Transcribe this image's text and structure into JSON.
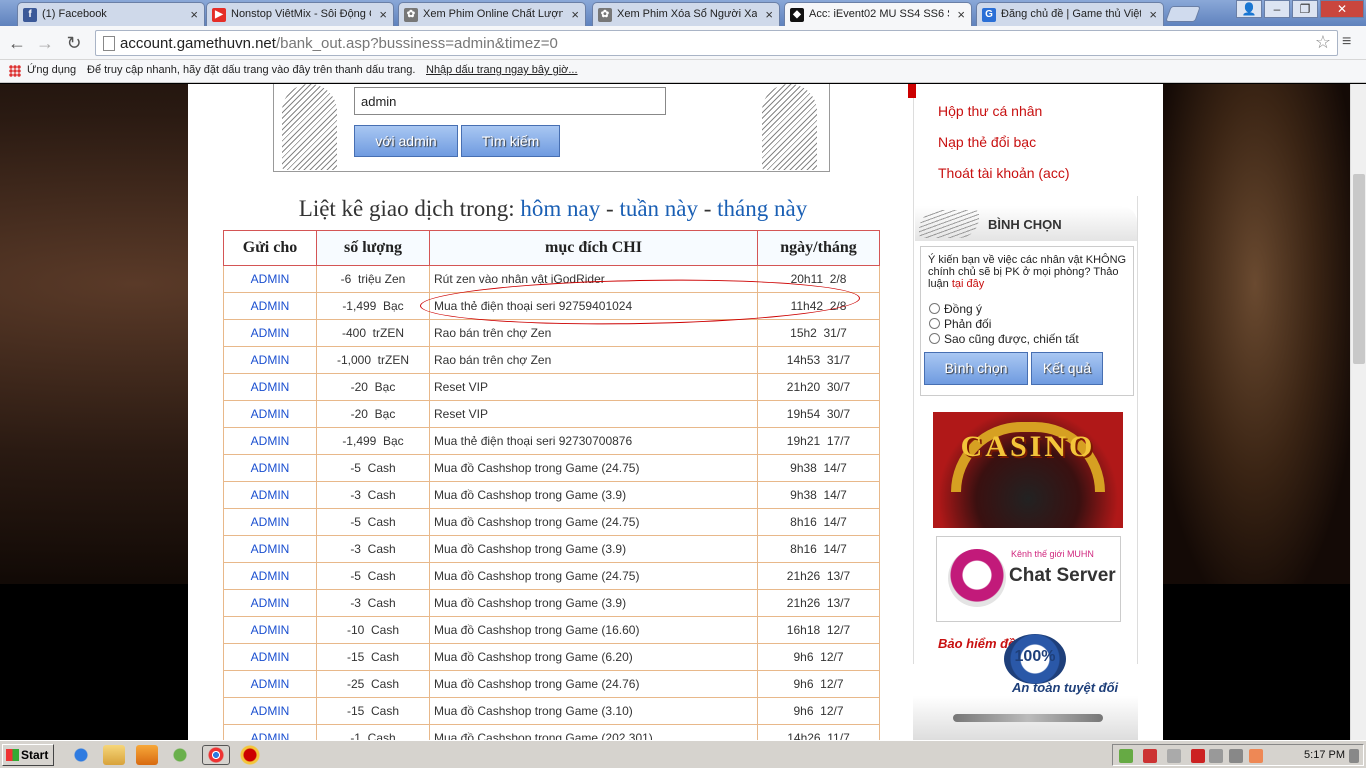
{
  "browser": {
    "tabs": [
      {
        "title": "(1) Facebook",
        "icon": "facebook-icon",
        "color": "#3b5998",
        "glyph": "f"
      },
      {
        "title": "Nonstop ViêtMix - Sôi Động C",
        "icon": "youtube-icon",
        "color": "#e52d27",
        "glyph": "▶"
      },
      {
        "title": "Xem Phim Online Chất Lượng",
        "icon": "film-icon",
        "color": "#777777",
        "glyph": "✿"
      },
      {
        "title": "Xem Phim Xóa Sổ Người Xay",
        "icon": "film-icon",
        "color": "#777777",
        "glyph": "✿"
      },
      {
        "title": "Acc: iEvent02 MU SS4 SS6 S",
        "icon": "gamethu-icon",
        "color": "#111111",
        "glyph": "◆"
      },
      {
        "title": "Đăng chủ đề | Game thủ Việt",
        "icon": "g-site-icon",
        "color": "#2a6fd6",
        "glyph": "G"
      }
    ],
    "active_tab": 4,
    "url_host": "account.gamethuvn.net",
    "url_path": "/bank_out.asp?bussiness=admin&timez=0",
    "bookmarks": {
      "apps_label": "Ứng dụng",
      "hint": "Để truy cập nhanh, hãy đặt dấu trang vào đây trên thanh dấu trang.",
      "import_link": "Nhập dấu trang ngay bây giờ..."
    }
  },
  "search": {
    "value": "admin",
    "btn_with": "với admin",
    "btn_search": "Tìm kiếm"
  },
  "list_title": {
    "prefix": "Liệt kê giao dịch trong: ",
    "today": "hôm nay",
    "sep": " - ",
    "week": "tuần này",
    "month": "tháng này"
  },
  "table": {
    "headers": [
      "Gửi cho",
      "số lượng",
      "mục đích CHI",
      "ngày/tháng"
    ],
    "rows": [
      [
        "ADMIN",
        "-6  triệu Zen",
        "Rút zen vào nhân vật iGodRider",
        "20h11  2/8"
      ],
      [
        "ADMIN",
        "-1,499  Bạc",
        "Mua thẻ điện thoại seri 92759401024",
        "11h42  2/8"
      ],
      [
        "ADMIN",
        "-400  trZEN",
        "Rao bán trên chợ Zen",
        "15h2  31/7"
      ],
      [
        "ADMIN",
        "-1,000  trZEN",
        "Rao bán trên chợ Zen",
        "14h53  31/7"
      ],
      [
        "ADMIN",
        "-20  Bạc",
        "Reset VIP",
        "21h20  30/7"
      ],
      [
        "ADMIN",
        "-20  Bạc",
        "Reset VIP",
        "19h54  30/7"
      ],
      [
        "ADMIN",
        "-1,499  Bạc",
        "Mua thẻ điện thoại seri 92730700876",
        "19h21  17/7"
      ],
      [
        "ADMIN",
        "-5  Cash",
        "Mua đồ Cashshop trong Game (24.75)",
        "9h38  14/7"
      ],
      [
        "ADMIN",
        "-3  Cash",
        "Mua đồ Cashshop trong Game (3.9)",
        "9h38  14/7"
      ],
      [
        "ADMIN",
        "-5  Cash",
        "Mua đồ Cashshop trong Game (24.75)",
        "8h16  14/7"
      ],
      [
        "ADMIN",
        "-3  Cash",
        "Mua đồ Cashshop trong Game (3.9)",
        "8h16  14/7"
      ],
      [
        "ADMIN",
        "-5  Cash",
        "Mua đồ Cashshop trong Game (24.75)",
        "21h26  13/7"
      ],
      [
        "ADMIN",
        "-3  Cash",
        "Mua đồ Cashshop trong Game (3.9)",
        "21h26  13/7"
      ],
      [
        "ADMIN",
        "-10  Cash",
        "Mua đồ Cashshop trong Game (16.60)",
        "16h18  12/7"
      ],
      [
        "ADMIN",
        "-15  Cash",
        "Mua đồ Cashshop trong Game (6.20)",
        "9h6  12/7"
      ],
      [
        "ADMIN",
        "-25  Cash",
        "Mua đồ Cashshop trong Game (24.76)",
        "9h6  12/7"
      ],
      [
        "ADMIN",
        "-15  Cash",
        "Mua đồ Cashshop trong Game (3.10)",
        "9h6  12/7"
      ],
      [
        "ADMIN",
        "-1  Cash",
        "Mua đồ Cashshop trong Game (202.301)",
        "14h26  11/7"
      ]
    ]
  },
  "sidebar": {
    "links": [
      "Hộp thư cá nhân",
      "Nạp thẻ đổi bạc",
      "Thoát tài khoản (acc)"
    ],
    "vote": {
      "title": "BÌNH CHỌN",
      "question": "Ý kiến bạn về việc các nhân vật KHÔNG chính chủ sẽ bị PK ở mọi phòng? Thảo luận ",
      "question_link": "tại đây",
      "options": [
        "Đồng ý",
        "Phản đối",
        "Sao cũng được, chiến tất"
      ],
      "btn_vote": "Bình chọn",
      "btn_result": "Kết quả"
    },
    "casino_text": "CASINO",
    "chat": {
      "small": "Kênh thế giới MUHN",
      "big": "Chat Server"
    },
    "insurance": {
      "top": "Bảo hiểm đồ",
      "percent": "100%",
      "bottom": "An toàn tuyệt đối"
    }
  },
  "taskbar": {
    "start_label": "Start",
    "clock": "5:17 PM"
  }
}
